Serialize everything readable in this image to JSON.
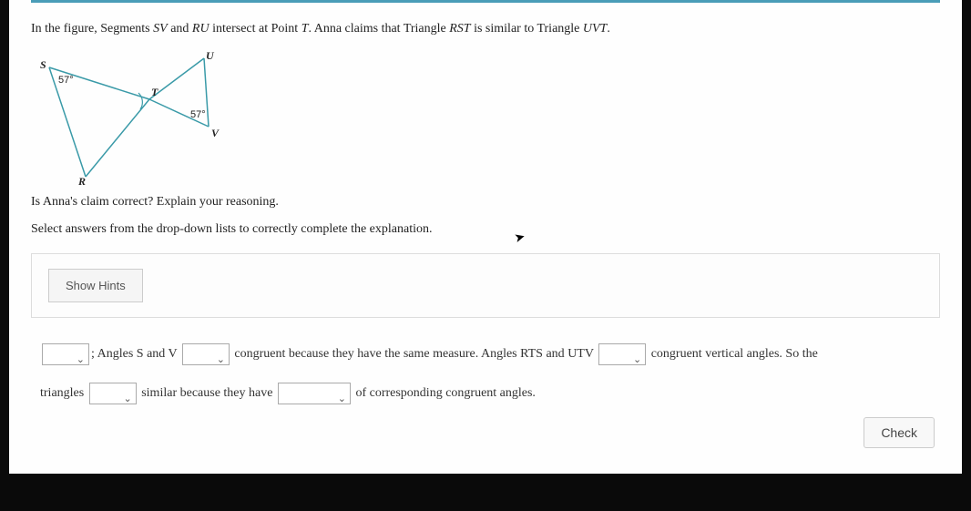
{
  "problem": {
    "intro_part1": "In the figure, Segments ",
    "seg1": "SV",
    "intro_part2": " and ",
    "seg2": "RU",
    "intro_part3": " intersect at Point ",
    "pointT": "T",
    "intro_part4": ". Anna claims that Triangle ",
    "tri1": "RST",
    "intro_part5": " is similar to Triangle ",
    "tri2": "UVT",
    "intro_part6": "."
  },
  "figure": {
    "labels": {
      "S": "S",
      "U": "U",
      "T": "T",
      "V": "V",
      "R": "R"
    },
    "angle_S": "57°",
    "angle_V": "57°"
  },
  "question": "Is Anna's claim correct? Explain your reasoning.",
  "instruction": "Select answers from the drop-down lists to correctly complete the explanation.",
  "hints_button": "Show Hints",
  "explanation": {
    "part1a": "; Angles ",
    "part1b": "S",
    "part1c": " and ",
    "part1d": "V",
    "part2": " congruent because they have the same measure. Angles ",
    "part2b": "RTS",
    "part2c": " and ",
    "part2d": "UTV",
    "part3": " congruent vertical angles. So the",
    "part4": "triangles ",
    "part5": " similar because they have ",
    "part6": " of corresponding congruent angles."
  },
  "check_button": "Check"
}
